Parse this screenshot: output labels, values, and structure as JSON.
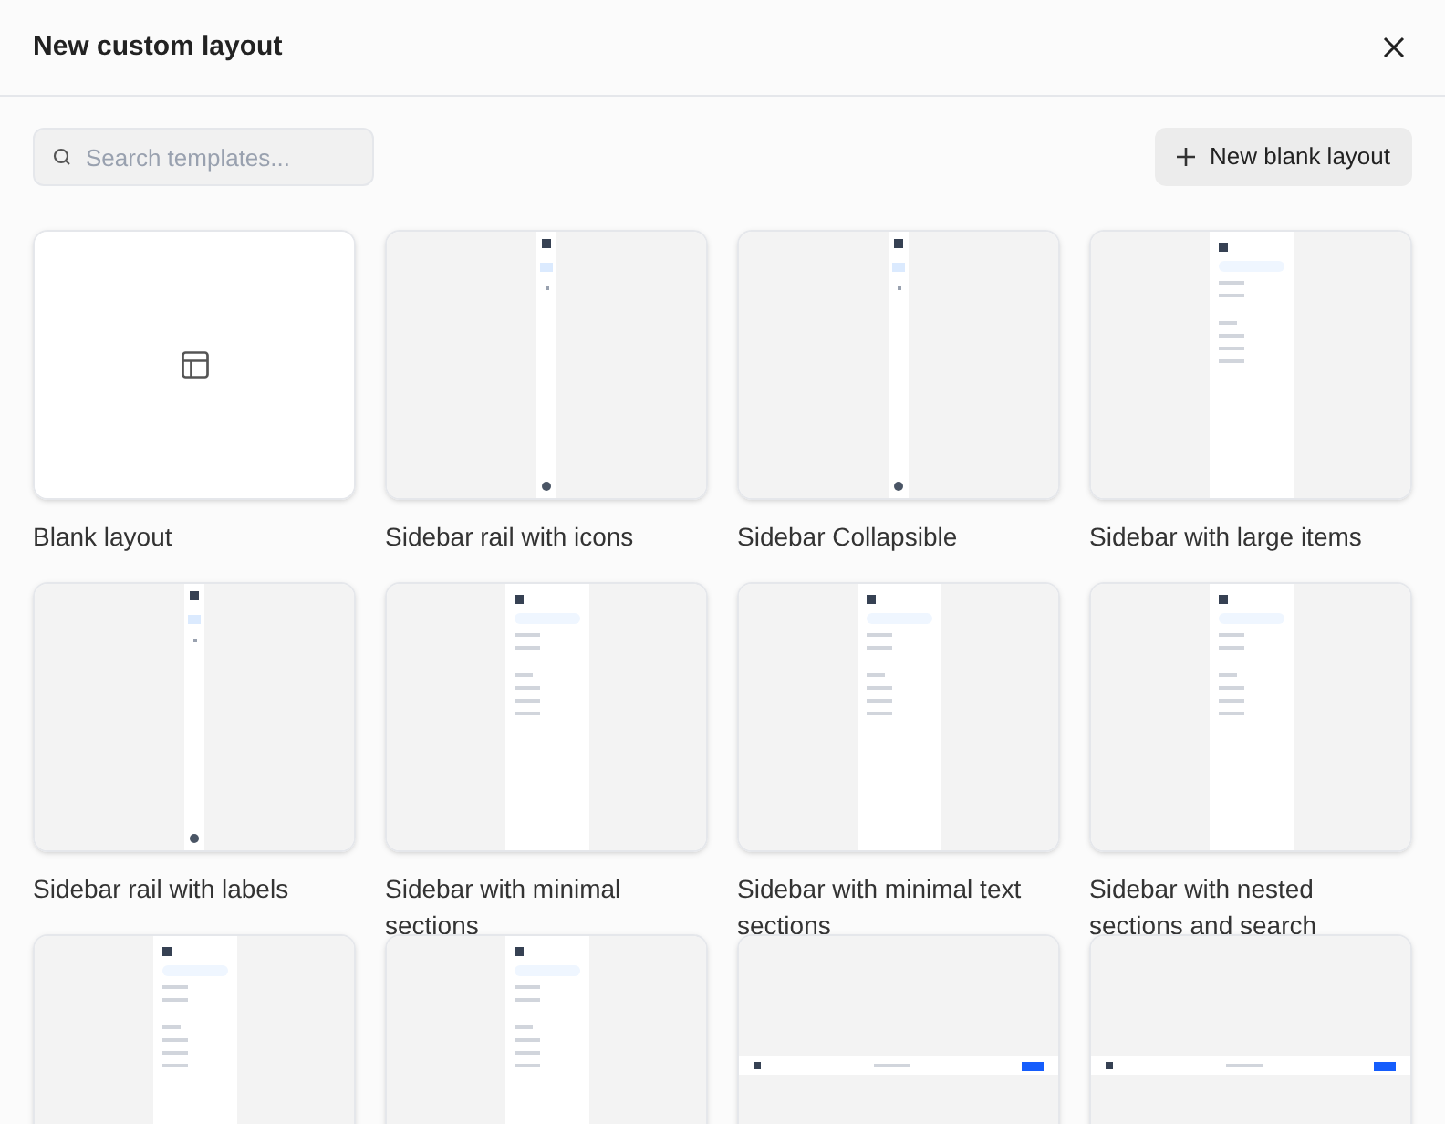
{
  "dialog": {
    "title": "New custom layout"
  },
  "search": {
    "placeholder": "Search templates..."
  },
  "new_button": {
    "label": "New blank layout"
  },
  "templates": [
    {
      "kind": "blank",
      "title": "Blank layout"
    },
    {
      "kind": "rail",
      "title": "Sidebar rail with icons"
    },
    {
      "kind": "rail",
      "title": "Sidebar Collapsible"
    },
    {
      "kind": "sidebar",
      "title": "Sidebar with large items"
    },
    {
      "kind": "rail",
      "title": "Sidebar rail with labels"
    },
    {
      "kind": "sidebar",
      "title": "Sidebar with minimal sections"
    },
    {
      "kind": "sidebar",
      "title": "Sidebar with minimal text sections"
    },
    {
      "kind": "sidebar",
      "title": "Sidebar with nested sections and search"
    },
    {
      "kind": "sidebar"
    },
    {
      "kind": "sidebar"
    },
    {
      "kind": "topbar"
    },
    {
      "kind": "topbar"
    }
  ]
}
